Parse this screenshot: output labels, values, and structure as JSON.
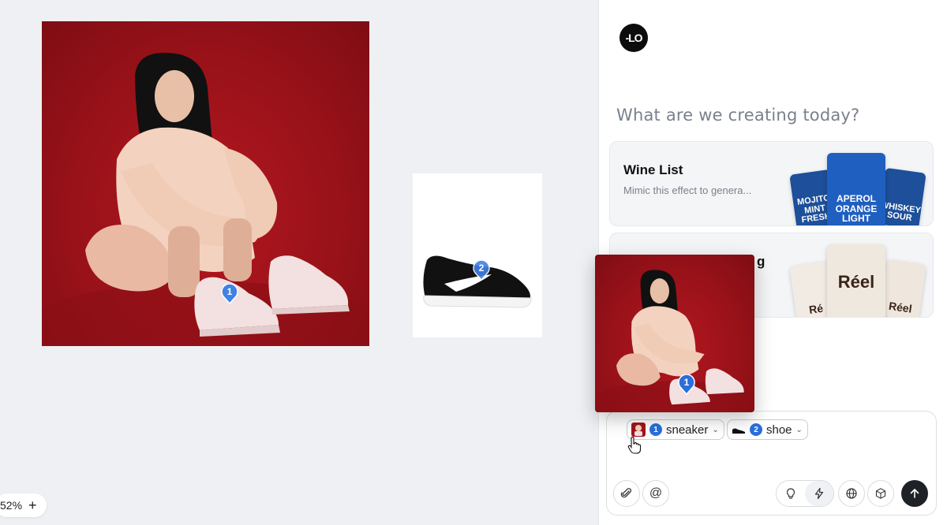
{
  "canvas": {
    "zoom_label": "52%",
    "zoom_in_symbol": "+",
    "pins": {
      "pin_1": "1",
      "pin_2": "2"
    }
  },
  "panel": {
    "logo_text": "-LO",
    "heading": "What are we creating today?",
    "cards": [
      {
        "title": "Wine List",
        "description": "Mimic this effect to genera...",
        "thumbs": [
          "MOJITO MINT FRESH",
          "APEROL ORANGE LIGHT",
          "WHISKEY SOUR"
        ]
      },
      {
        "title_visible_suffix": "g",
        "thumbs": [
          "Ré",
          "Réel",
          "Réel"
        ]
      }
    ]
  },
  "composer": {
    "chips": [
      {
        "number": "1",
        "label": "sneaker"
      },
      {
        "number": "2",
        "label": "shoe"
      }
    ],
    "buttons": {
      "attach": "paperclip-icon",
      "mention": "@",
      "idea": "lightbulb-icon",
      "quick": "bolt-icon",
      "web": "globe-icon",
      "model": "cube-icon",
      "send": "arrow-up-icon"
    }
  },
  "colors": {
    "photo_red": "#9a1219",
    "pin_blue": "#2a6fdb",
    "send_dark": "#1e2227"
  }
}
